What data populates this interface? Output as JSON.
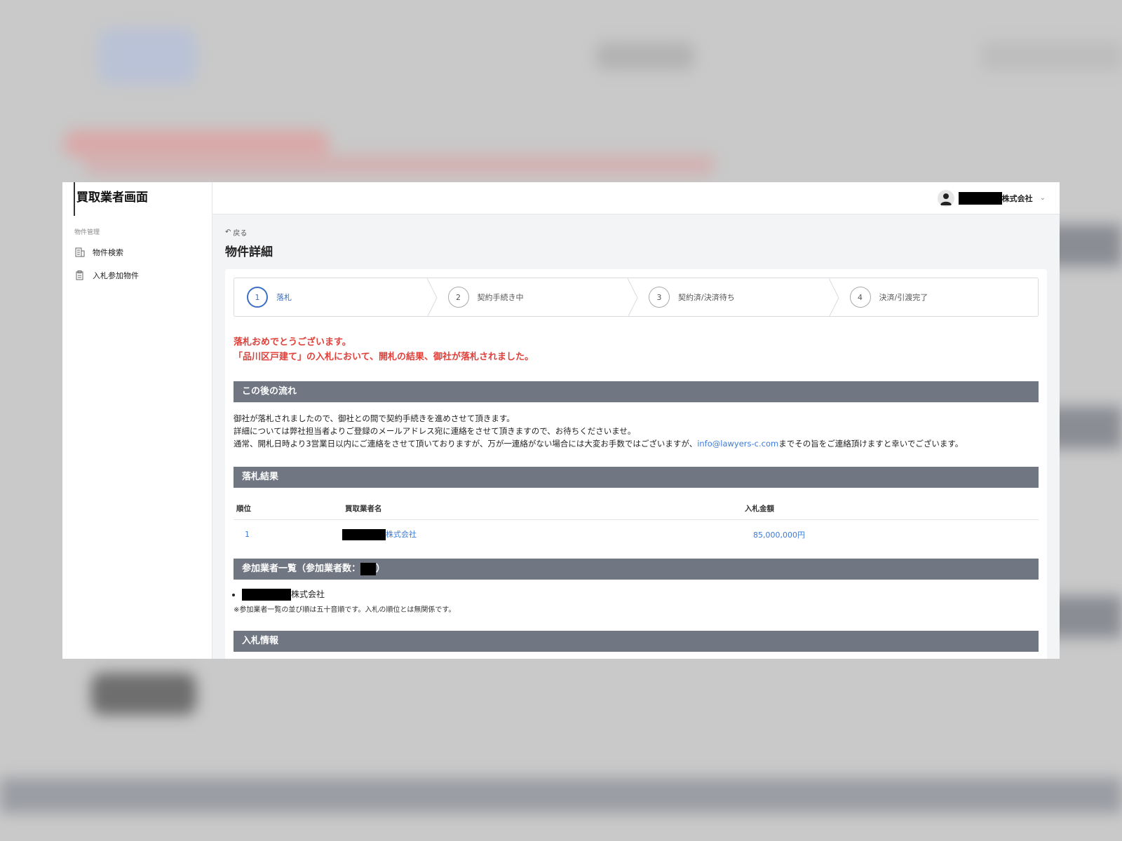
{
  "app": {
    "brand": "買取業者画面"
  },
  "sidebar": {
    "section_label": "物件管理",
    "items": [
      {
        "label": "物件検索",
        "icon": "building-icon"
      },
      {
        "label": "入札参加物件",
        "icon": "clipboard-icon"
      }
    ]
  },
  "header": {
    "user_suffix": "株式会社"
  },
  "page": {
    "back_label": "戻る",
    "title": "物件詳細"
  },
  "steps": [
    {
      "num": "1",
      "label": "落札",
      "active": true
    },
    {
      "num": "2",
      "label": "契約手続き中",
      "active": false
    },
    {
      "num": "3",
      "label": "契約済/決済待ち",
      "active": false
    },
    {
      "num": "4",
      "label": "決済/引渡完了",
      "active": false
    }
  ],
  "congrats": {
    "line1": "落札おめでとうございます。",
    "line2": "「品川区戸建て」の入札において、開札の結果、御社が落札されました。"
  },
  "flow": {
    "heading": "この後の流れ",
    "line1": "御社が落札されましたので、御社との間で契約手続きを進めさせて頂きます。",
    "line2": "詳細については弊社担当者よりご登録のメールアドレス宛に連絡をさせて頂きますので、お待ちくださいませ。",
    "line3_pre": "通常、開札日時より3営業日以内にご連絡をさせて頂いておりますが、万が一連絡がない場合には大変お手数ではございますが、",
    "email": "info@lawyers-c.com",
    "line3_post": "までその旨をご連絡頂けますと幸いでございます。"
  },
  "results": {
    "heading": "落札結果",
    "columns": [
      "順位",
      "買取業者名",
      "入札金額"
    ],
    "rows": [
      {
        "rank": "1",
        "name_suffix": "株式会社",
        "amount": "85,000,000円"
      }
    ]
  },
  "participants": {
    "heading_pre": "参加業者一覧（参加業者数：",
    "heading_post": "）",
    "items": [
      {
        "name_suffix": "株式会社"
      }
    ],
    "note": "※参加業者一覧の並び順は五十音順です。入札の順位とは無関係です。"
  },
  "bid_info": {
    "heading": "入札情報"
  },
  "colors": {
    "accent": "#3c6fc4",
    "link": "#3c7ad8",
    "alert": "#e0403a",
    "section_header": "#707682"
  }
}
